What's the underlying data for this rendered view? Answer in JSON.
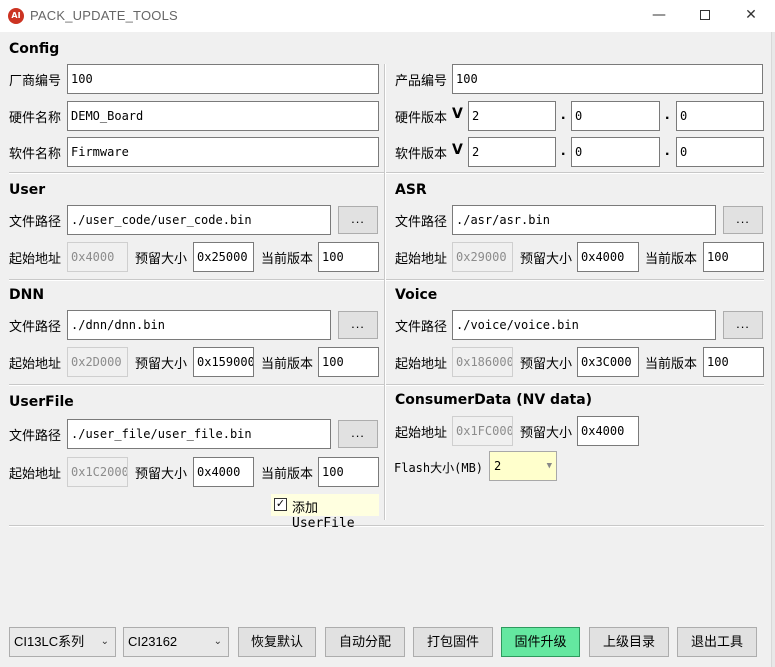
{
  "window": {
    "title": "PACK_UPDATE_TOOLS",
    "icon_text": "AI",
    "min": "—",
    "close": "✕"
  },
  "config": {
    "heading": "Config",
    "vendor_label": "厂商编号",
    "vendor_value": "100",
    "product_label": "产品编号",
    "product_value": "100",
    "hw_name_label": "硬件名称",
    "hw_name_value": "DEMO_Board",
    "hw_ver_label": "硬件版本",
    "hw_ver": [
      "2",
      "0",
      "0"
    ],
    "sw_name_label": "软件名称",
    "sw_name_value": "Firmware",
    "sw_ver_label": "软件版本",
    "sw_ver": [
      "2",
      "0",
      "0"
    ],
    "v_mark": "V",
    "dot": "."
  },
  "user": {
    "heading": "User",
    "path_label": "文件路径",
    "path": "./user_code/user_code.bin",
    "start_label": "起始地址",
    "start": "0x4000",
    "reserve_label": "预留大小",
    "reserve": "0x25000",
    "ver_label": "当前版本",
    "ver": "100"
  },
  "asr": {
    "heading": "ASR",
    "path_label": "文件路径",
    "path": "./asr/asr.bin",
    "start_label": "起始地址",
    "start": "0x29000",
    "reserve_label": "预留大小",
    "reserve": "0x4000",
    "ver_label": "当前版本",
    "ver": "100"
  },
  "dnn": {
    "heading": "DNN",
    "path_label": "文件路径",
    "path": "./dnn/dnn.bin",
    "start_label": "起始地址",
    "start": "0x2D000",
    "reserve_label": "预留大小",
    "reserve": "0x159000",
    "ver_label": "当前版本",
    "ver": "100"
  },
  "voice": {
    "heading": "Voice",
    "path_label": "文件路径",
    "path": "./voice/voice.bin",
    "start_label": "起始地址",
    "start": "0x186000",
    "reserve_label": "预留大小",
    "reserve": "0x3C000",
    "ver_label": "当前版本",
    "ver": "100"
  },
  "userfile": {
    "heading": "UserFile",
    "path_label": "文件路径",
    "path": "./user_file/user_file.bin",
    "start_label": "起始地址",
    "start": "0x1C2000",
    "reserve_label": "预留大小",
    "reserve": "0x4000",
    "ver_label": "当前版本",
    "ver": "100",
    "add_checkbox_label": "添加UserFile",
    "add_checked": true,
    "check_mark": "✓"
  },
  "consumer": {
    "heading": "ConsumerData (NV data)",
    "start_label": "起始地址",
    "start": "0x1FC000",
    "reserve_label": "预留大小",
    "reserve": "0x4000",
    "flash_label": "Flash大小(MB)",
    "flash_value": "2"
  },
  "browse_label": "...",
  "footer": {
    "series_select": "CI13LC系列",
    "chip_select": "CI23162",
    "restore_default": "恢复默认",
    "auto_allocate": "自动分配",
    "pack_firmware": "打包固件",
    "upgrade_firmware": "固件升级",
    "parent_dir": "上级目录",
    "exit_tool": "退出工具"
  },
  "colors": {
    "accent_button": "#64e8a0",
    "highlight": "#ffffcc",
    "checkbox_bg": "#ffffe0"
  }
}
